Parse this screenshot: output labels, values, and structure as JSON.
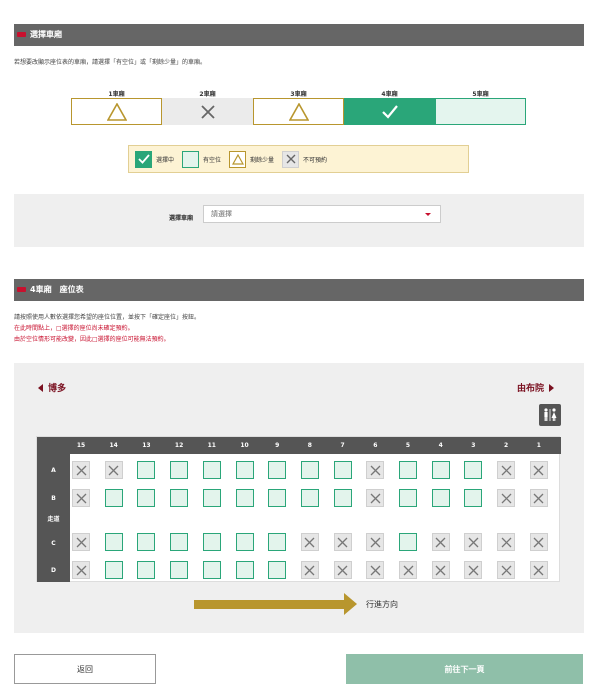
{
  "select_car": {
    "header": "選擇車廂",
    "desc": "若想要改顯示座位表的車廂，請選擇「有空位」或「剩餘少量」的車廂。",
    "cars": [
      {
        "label": "1車廂",
        "status": "avail"
      },
      {
        "label": "2車廂",
        "status": "full"
      },
      {
        "label": "3車廂",
        "status": "avail"
      },
      {
        "label": "4車廂",
        "status": "selected"
      },
      {
        "label": "5車廂",
        "status": "few"
      }
    ],
    "legend": [
      {
        "key": "selected",
        "label": "選擇中"
      },
      {
        "key": "few",
        "label": "有空位"
      },
      {
        "key": "avail",
        "label": "剩餘少量"
      },
      {
        "key": "full",
        "label": "不可預約"
      }
    ],
    "picker_label": "選擇車廂",
    "picker_value": "請選擇"
  },
  "seat_map": {
    "header": "4車廂　座位表",
    "desc_1": "請按照使用人數依選擇您希望的座位位置，並按下「確定座位」按鈕。",
    "desc_2": "在此時間點上，□選擇的座位尚未確定預約。",
    "desc_3": "由於空位情形可能改變，因此□選擇的座位可能無法預約。",
    "from_label": "博多",
    "to_label": "由布院",
    "columns": [
      "15",
      "14",
      "13",
      "12",
      "11",
      "10",
      "9",
      "8",
      "7",
      "6",
      "5",
      "4",
      "3",
      "2",
      "1"
    ],
    "rows": [
      {
        "label": "A",
        "seats": "xxaaaaaaaxaaaxx"
      },
      {
        "label": "B",
        "seats": "xaaaaaaaaxaaaxx"
      },
      {
        "label": "C",
        "seats": "xaaaaaaxxxaxxxx"
      },
      {
        "label": "D",
        "seats": "xaaaaaaxxxxxxxx"
      }
    ],
    "aisle_label": "走道",
    "direction_label": "行進方向"
  },
  "buttons": {
    "back": "返回",
    "next": "前往下一頁"
  },
  "colors": {
    "accent_red": "#c8102e",
    "green": "#2aa679",
    "gold": "#b8962e"
  }
}
